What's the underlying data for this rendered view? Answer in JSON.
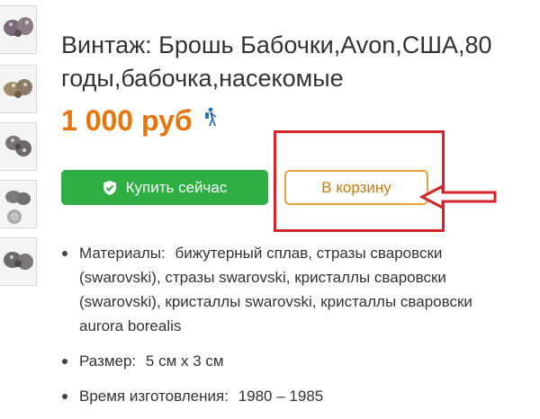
{
  "product": {
    "title_line1": "Винтаж: Брошь Бабочки,Avon,США,80",
    "title_line2": "годы,бабочка,насекомые",
    "price": "1 000 руб"
  },
  "actions": {
    "buy_now_label": "Купить сейчас",
    "add_to_cart_label": "В корзину"
  },
  "details": {
    "materials_label": "Материалы:",
    "materials_lines": [
      "бижутерный сплав, стразы сваровски",
      "(swarovski), стразы swarovski, кристаллы сваровски",
      "(swarovski), кристаллы swarovski, кристаллы сваровски",
      "aurora borealis"
    ],
    "size_label": "Размер:",
    "size_value": "5 см x 3 см",
    "made_label": "Время изготовления:",
    "made_value": "1980 – 1985"
  },
  "colors": {
    "price": "#e8740c",
    "buy_button": "#2eae43",
    "cart_border": "#e8a23b",
    "annotation_red": "#d4252b"
  },
  "icons": [
    "shield-check-icon",
    "hiker-icon",
    "arrow-left-icon"
  ]
}
